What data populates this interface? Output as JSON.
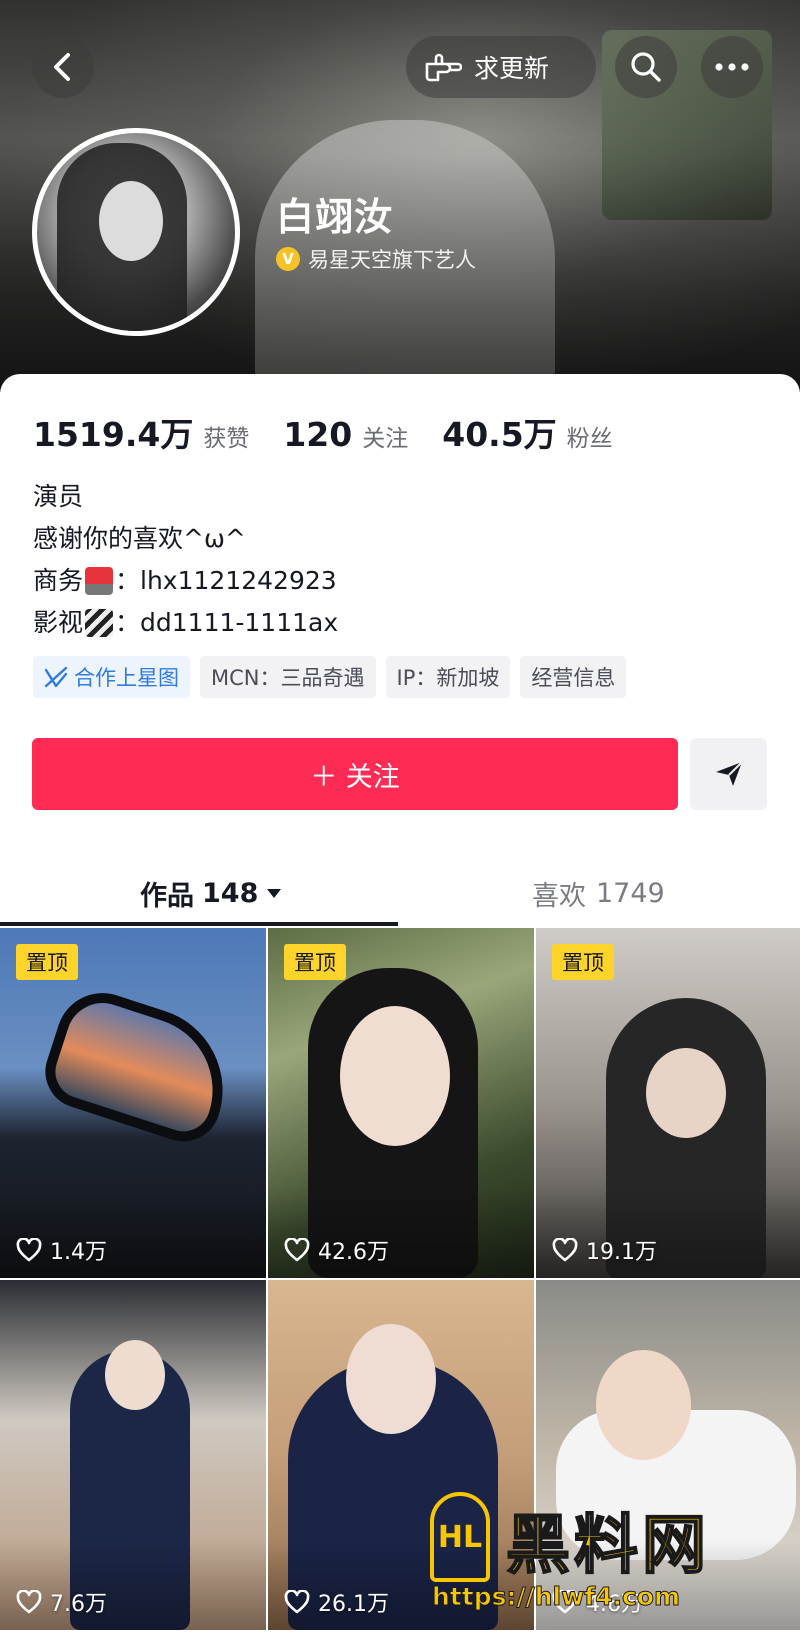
{
  "header": {
    "request_update_label": "求更新",
    "name": "白翊汝",
    "verify_badge": "V",
    "verify_text": "易星天空旗下艺人"
  },
  "stats": [
    {
      "num": "1519.4万",
      "label": "获赞"
    },
    {
      "num": "120",
      "label": "关注"
    },
    {
      "num": "40.5万",
      "label": "粉丝"
    }
  ],
  "bio": {
    "line1": "演员",
    "line2": "感谢你的喜欢^ω^",
    "business_label": "商务",
    "business_value": "：lhx1121242923",
    "film_label": "影视",
    "film_value": "：dd1111-1111ax"
  },
  "tags": {
    "star_map": "合作上星图",
    "mcn": "MCN：三品奇遇",
    "ip": "IP：新加坡",
    "business_info": "经营信息"
  },
  "actions": {
    "follow": "＋ 关注"
  },
  "tabs": {
    "works_label": "作品",
    "works_count": "148",
    "likes_label": "喜欢",
    "likes_count": "1749"
  },
  "videos": [
    {
      "pinned": "置顶",
      "likes": "1.4万"
    },
    {
      "pinned": "置顶",
      "likes": "42.6万"
    },
    {
      "pinned": "置顶",
      "likes": "19.1万"
    },
    {
      "likes": "7.6万"
    },
    {
      "likes": "26.1万"
    },
    {
      "likes": "4.6万"
    }
  ],
  "watermark": {
    "logo": "HL",
    "title": "黑料网",
    "url": "https://hlwf4.com"
  },
  "colors": {
    "accent": "#fe2c55",
    "pin": "#ffd42a",
    "verify": "#f7c227",
    "link_blue": "#2f7be4"
  }
}
